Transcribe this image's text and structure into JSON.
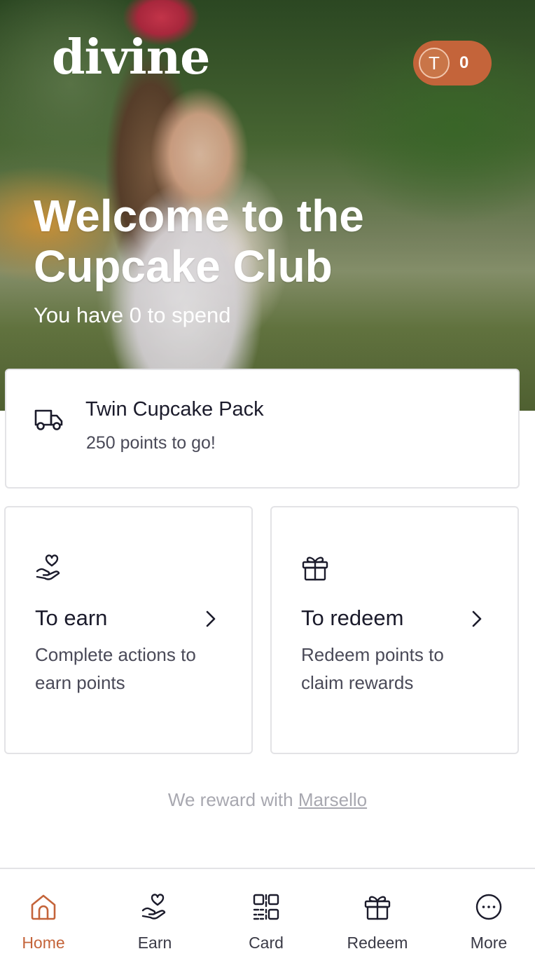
{
  "brand": {
    "logo_text": "divine",
    "accent": "#c4643a"
  },
  "header": {
    "avatar_initial": "T",
    "points": "0"
  },
  "hero": {
    "title": "Welcome to the Cupcake Club",
    "subtitle": "You have 0 to spend"
  },
  "goal": {
    "icon": "truck-icon",
    "title": "Twin Cupcake Pack",
    "subtitle": "250 points to go!"
  },
  "tiles": [
    {
      "icon": "heart-hand-icon",
      "title": "To earn",
      "description": "Complete actions to earn points"
    },
    {
      "icon": "gift-icon",
      "title": "To redeem",
      "description": "Redeem points to claim rewards"
    }
  ],
  "footer": {
    "prefix": "We reward with ",
    "link": "Marsello"
  },
  "nav": [
    {
      "label": "Home",
      "icon": "home-icon",
      "active": true
    },
    {
      "label": "Earn",
      "icon": "heart-hand-icon",
      "active": false
    },
    {
      "label": "Card",
      "icon": "qr-code-icon",
      "active": false
    },
    {
      "label": "Redeem",
      "icon": "gift-icon",
      "active": false
    },
    {
      "label": "More",
      "icon": "more-icon",
      "active": false
    }
  ]
}
